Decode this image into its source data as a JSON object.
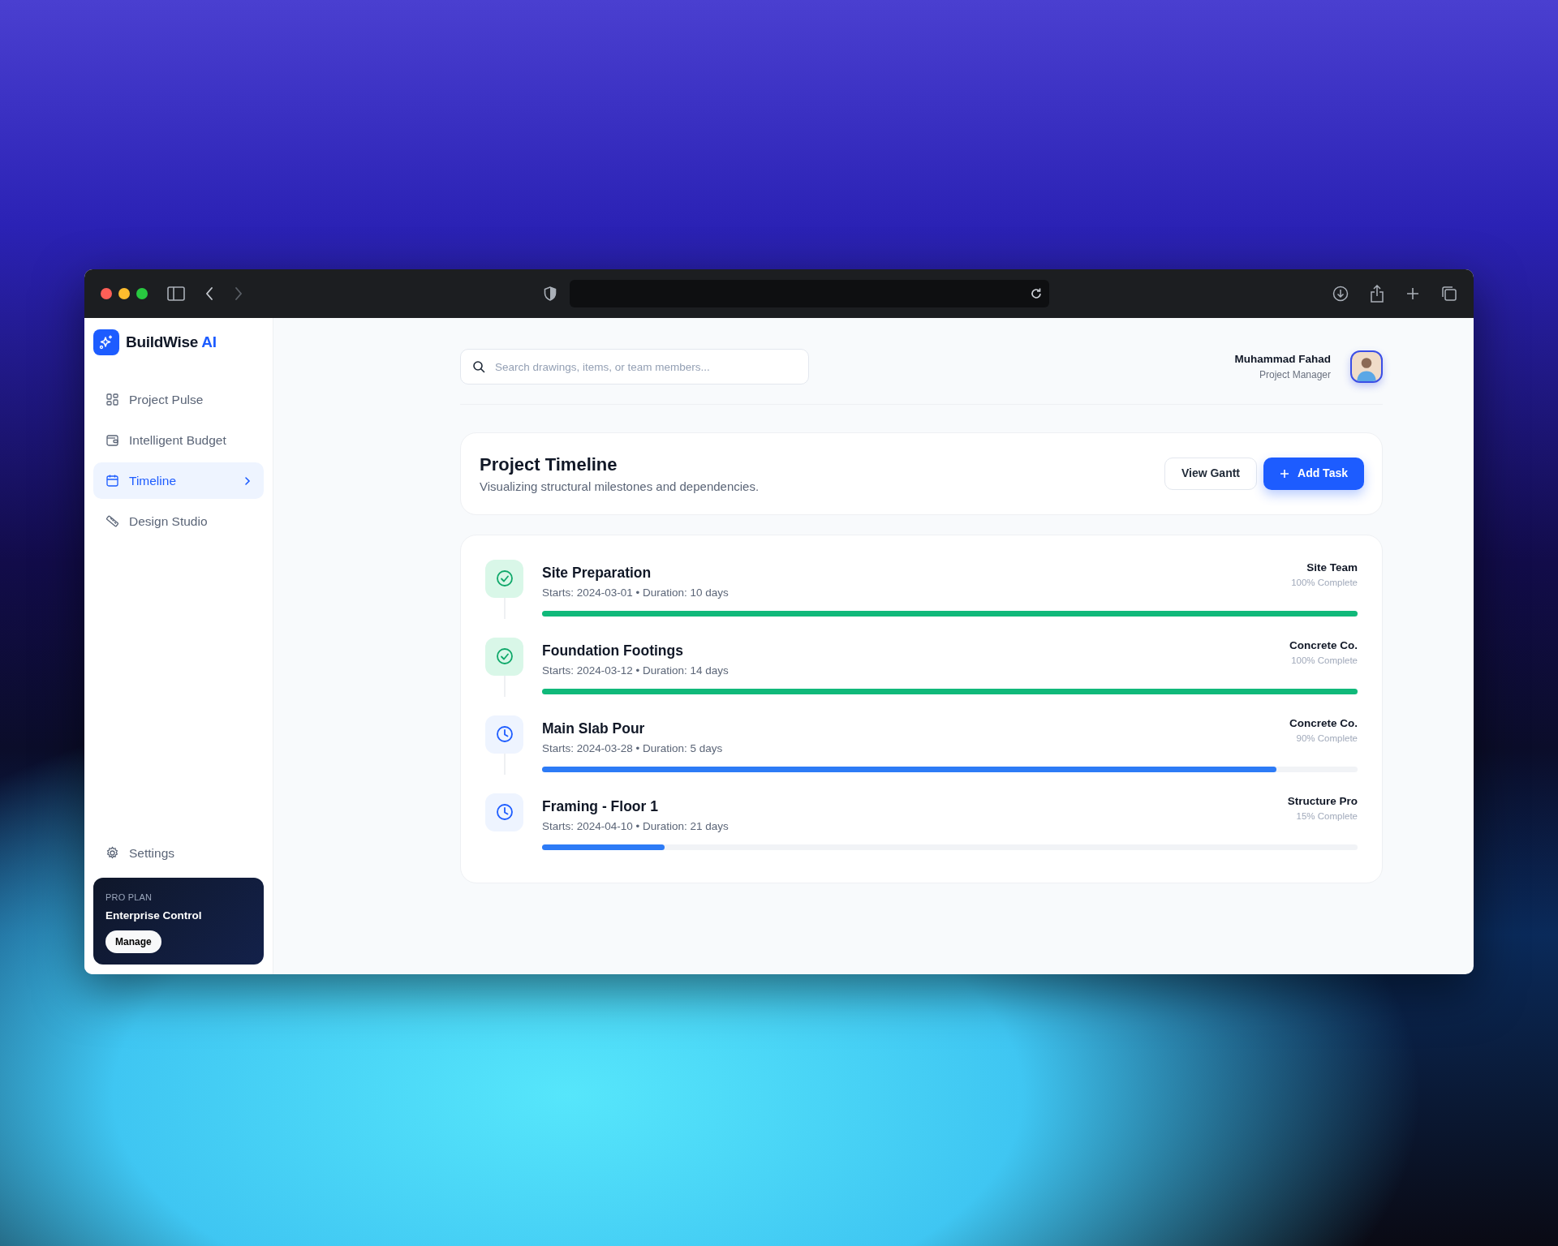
{
  "browser": {
    "back_enabled": true,
    "forward_enabled": false
  },
  "sidebar": {
    "brand": {
      "name": "BuildWise",
      "accent": "AI"
    },
    "items": [
      {
        "label": "Project Pulse",
        "selected": false
      },
      {
        "label": "Intelligent Budget",
        "selected": false
      },
      {
        "label": "Timeline",
        "selected": true
      },
      {
        "label": "Design Studio",
        "selected": false
      }
    ],
    "settings": {
      "label": "Settings"
    },
    "plan": {
      "eyebrow": "PRO PLAN",
      "title": "Enterprise Control",
      "button": "Manage"
    }
  },
  "topbar": {
    "search": {
      "placeholder": "Search drawings, items, or team members..."
    },
    "user": {
      "name": "Muhammad Fahad",
      "role": "Project Manager"
    }
  },
  "header": {
    "title": "Project Timeline",
    "subtitle": "Visualizing structural milestones and dependencies.",
    "buttons": [
      {
        "label": "View Gantt",
        "kind": "outline"
      },
      {
        "label": "Add Task",
        "kind": "primary"
      }
    ]
  },
  "tasks": [
    {
      "name": "Site Preparation",
      "meta": "Starts: 2024-03-01 • Duration: 10 days",
      "team": "Site Team",
      "progress_text": "100% Complete",
      "level": 1,
      "completed": true
    },
    {
      "name": "Foundation Footings",
      "meta": "Starts: 2024-03-12 • Duration: 14 days",
      "team": "Concrete Co.",
      "progress_text": "100% Complete",
      "level": 1,
      "completed": true
    },
    {
      "name": "Main Slab Pour",
      "meta": "Starts: 2024-03-28 • Duration: 5 days",
      "team": "Concrete Co.",
      "progress_text": "90% Complete",
      "level": 0.9,
      "completed": false
    },
    {
      "name": "Framing - Floor 1",
      "meta": "Starts: 2024-04-10 • Duration: 21 days",
      "team": "Structure Pro",
      "progress_text": "15% Complete",
      "level": 0.15,
      "completed": false
    }
  ]
}
